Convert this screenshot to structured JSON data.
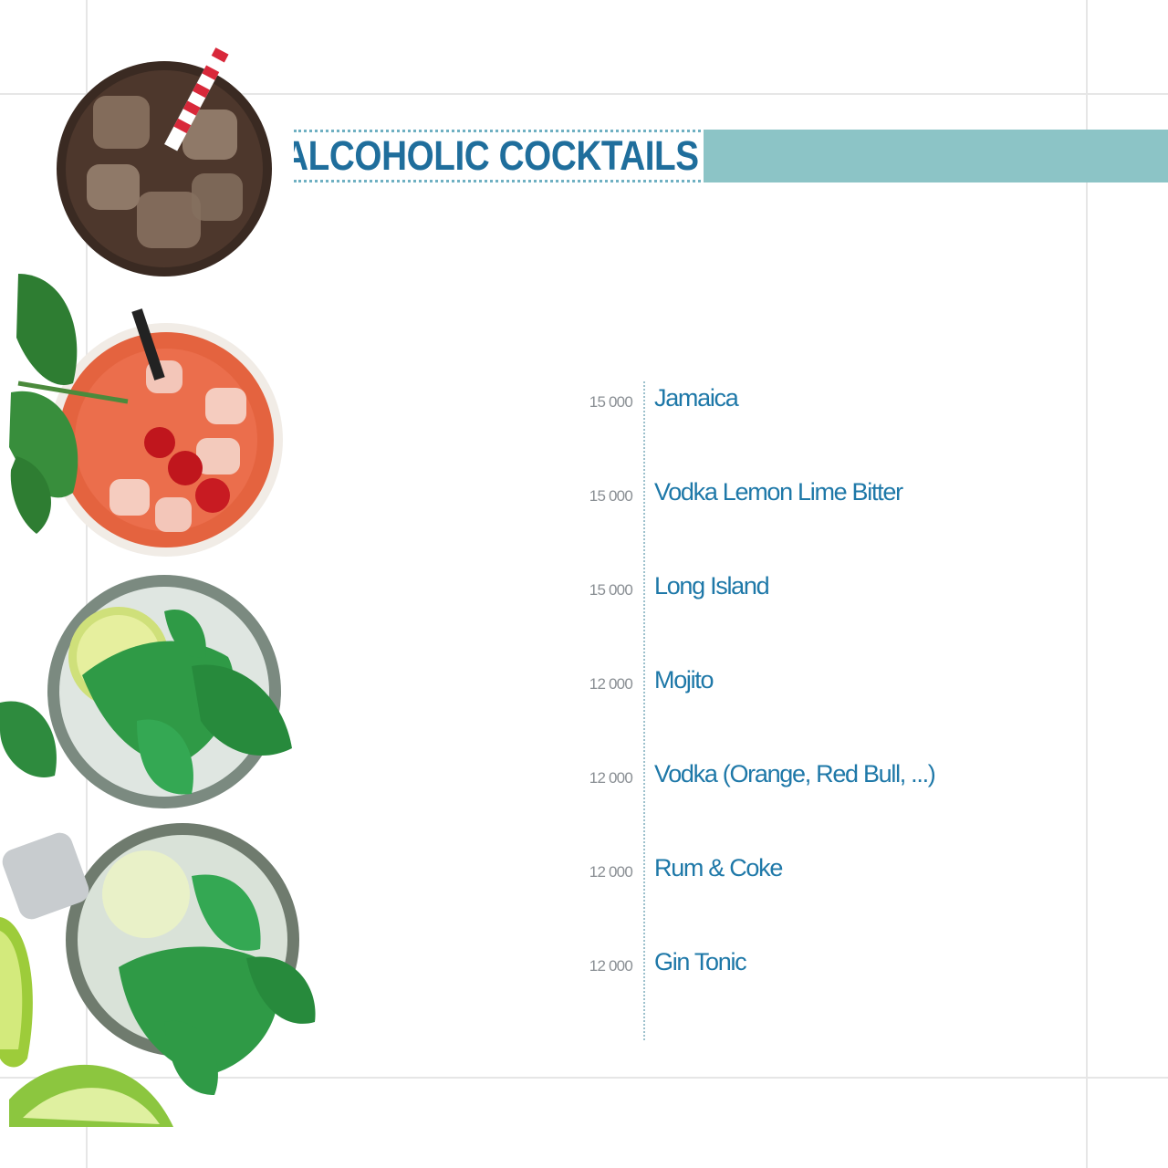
{
  "menu": {
    "title": "ALCOHOLIC COCKTAILS",
    "items": [
      {
        "price": "15 000",
        "name": "Jamaica"
      },
      {
        "price": "15 000",
        "name": "Vodka Lemon Lime Bitter"
      },
      {
        "price": "15 000",
        "name": "Long Island"
      },
      {
        "price": "12 000",
        "name": "Mojito"
      },
      {
        "price": "12 000",
        "name": "Vodka (Orange, Red Bull, ...)"
      },
      {
        "price": "12 000",
        "name": "Rum & Coke"
      },
      {
        "price": "12 000",
        "name": "Gin Tonic"
      }
    ]
  },
  "colors": {
    "title_text": "#1f6e9c",
    "title_bar": "#8cc4c6",
    "item_name": "#1e78a8",
    "item_price": "#8a8f94"
  },
  "images": [
    "cola-glass",
    "red-cocktail-glass",
    "mojito-glass",
    "mojito-glass-with-lime"
  ]
}
